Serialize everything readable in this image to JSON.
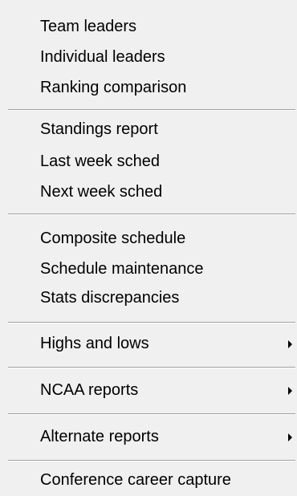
{
  "menu": {
    "items": [
      {
        "label": "Team leaders"
      },
      {
        "label": "Individual leaders"
      },
      {
        "label": "Ranking comparison"
      },
      {
        "label": "Standings report"
      },
      {
        "label": "Last week sched"
      },
      {
        "label": "Next week sched"
      },
      {
        "label": "Composite schedule"
      },
      {
        "label": "Schedule maintenance"
      },
      {
        "label": "Stats discrepancies"
      },
      {
        "label": "Highs and lows",
        "submenu_icon": "submenu-arrow-icon"
      },
      {
        "label": "NCAA reports",
        "submenu_icon": "submenu-arrow-icon"
      },
      {
        "label": "Alternate reports",
        "submenu_icon": "submenu-arrow-icon"
      },
      {
        "label": "Conference career capture"
      }
    ]
  }
}
